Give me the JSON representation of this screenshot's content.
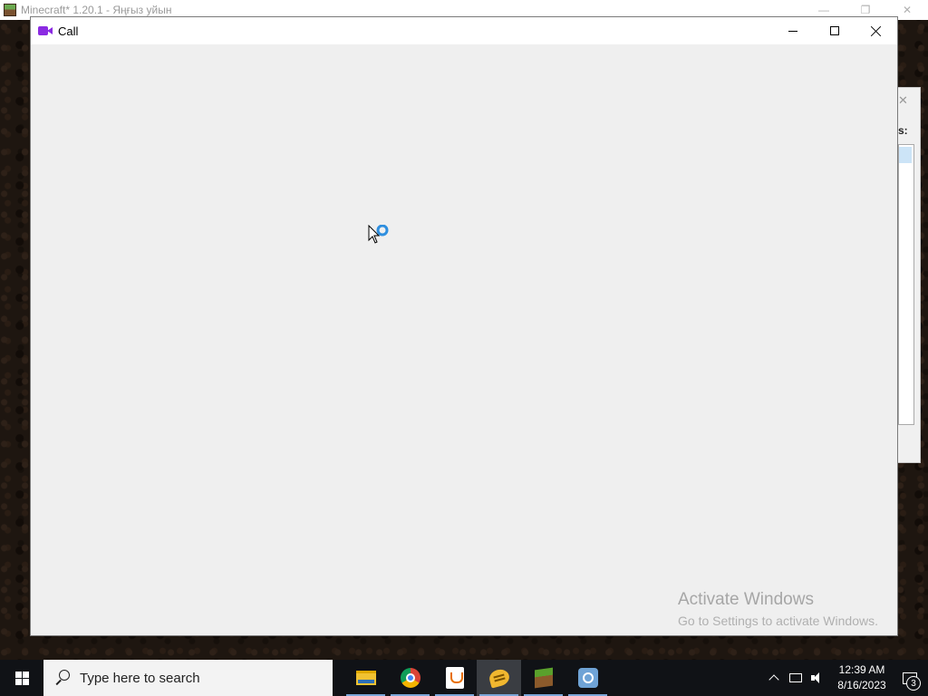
{
  "background_window": {
    "title": "Minecraft* 1.20.1 - Яңғыз уйын",
    "controls": [
      "minimize",
      "restore",
      "close"
    ]
  },
  "side_dialog": {
    "close_glyph": "✕",
    "label_fragment": "s:"
  },
  "call_window": {
    "title": "Call",
    "icon": "video-camera-icon",
    "accent_color": "#8b2be2",
    "controls": [
      "minimize",
      "maximize",
      "close"
    ],
    "body_background": "#efefef"
  },
  "cursor": {
    "state": "busy",
    "accent_color": "#2f8fdf"
  },
  "watermark": {
    "title": "Activate Windows",
    "subtitle": "Go to Settings to activate Windows."
  },
  "taskbar": {
    "search_placeholder": "Type here to search",
    "apps": [
      {
        "name": "File Explorer",
        "icon": "folder-icon",
        "running": true,
        "active": false
      },
      {
        "name": "Google Chrome",
        "icon": "chrome-icon",
        "running": true,
        "active": false
      },
      {
        "name": "Java",
        "icon": "java-icon",
        "running": true,
        "active": false
      },
      {
        "name": "Chat",
        "icon": "chat-bubble-icon",
        "running": true,
        "active": true
      },
      {
        "name": "Minecraft",
        "icon": "grass-block-icon",
        "running": true,
        "active": false
      },
      {
        "name": "Network utility",
        "icon": "globe-icon",
        "running": true,
        "active": false
      }
    ],
    "clock": {
      "time": "12:39 AM",
      "date": "8/16/2023"
    },
    "notification_count": "3"
  }
}
